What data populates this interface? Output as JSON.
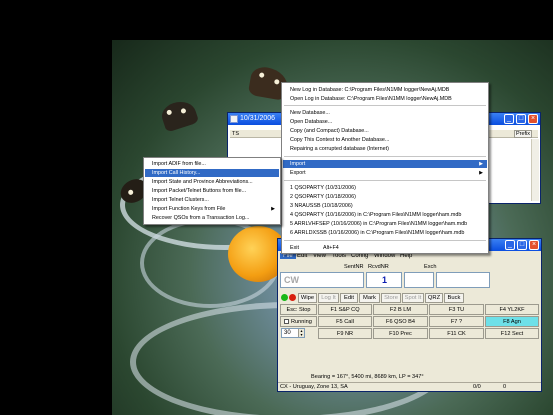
{
  "background_window": {
    "title": "10/31/2006",
    "column_a": "TS",
    "column_b": "Prefix"
  },
  "file_menu": {
    "items": [
      {
        "label": "New Log in Database: C:\\Program Files\\N1MM logger\\NewAj.MDB"
      },
      {
        "label": "Open Log in Database: C:\\Program Files\\N1MM logger\\NewAj.MDB"
      },
      {
        "label": "New Database..."
      },
      {
        "label": "Open Database..."
      },
      {
        "label": "Copy (and Compact) Database..."
      },
      {
        "label": "Copy This Contest to Another Database..."
      },
      {
        "label": "Repairing a corrupted database (Internet)"
      },
      {
        "label": "Import"
      },
      {
        "label": "Export"
      },
      {
        "label": "1 QSOPARTY (10/31/2006)"
      },
      {
        "label": "2 QSOPARTY (10/18/2006)"
      },
      {
        "label": "3 NRAUSSB (10/18/2006)"
      },
      {
        "label": "4 QSOPARTY (10/16/2006) in C:\\Program Files\\N1MM logger\\ham.mdb"
      },
      {
        "label": "5 ARRLVHFSEP (10/16/2006) in C:\\Program Files\\N1MM logger\\ham.mdb"
      },
      {
        "label": "6 ARRLDXSSB (10/16/2006) in C:\\Program Files\\N1MM logger\\ham.mdb"
      },
      {
        "label": "Exit",
        "shortcut": "Alt+F4"
      }
    ]
  },
  "import_submenu": {
    "items": [
      {
        "label": "Import ADIF from file..."
      },
      {
        "label": "Import Call History..."
      },
      {
        "label": "Import State and Province Abbreviations..."
      },
      {
        "label": "Import Packet/Telnet Buttons from file..."
      },
      {
        "label": "Import Telnet Clusters..."
      },
      {
        "label": "Import Function Keys from File"
      },
      {
        "label": "Recover QSOs from a Transaction Log..."
      }
    ]
  },
  "entry_window": {
    "menubar": [
      "File",
      "Edit",
      "View",
      "Tools",
      "Config",
      "Window",
      "Help"
    ],
    "headers": [
      "SentNR",
      "RcvdNR",
      "Exch"
    ],
    "call_placeholder": "CW",
    "sent_nr": "1",
    "buttons": [
      "Wipe",
      "Log It",
      "Edit",
      "Mark",
      "Store",
      "Spot It",
      "QRZ",
      "Buck"
    ],
    "disabled_buttons": [
      "Log It",
      "Store",
      "Spot It"
    ],
    "keys": [
      [
        "Esc: Stop",
        "F1 S&P CQ",
        "F2 B LM",
        "F3 TU",
        "F4 YL2KF"
      ],
      [
        "Running",
        "F5 Call",
        "F6 QSO B4",
        "F7 ?",
        "F8 Agn"
      ],
      [
        "30",
        "F9 NR",
        "F10 Prec",
        "F11 CK",
        "F12 Sect"
      ]
    ],
    "selected_key": "F8 Agn",
    "bearing_text": "Bearing = 167°, 5400  mi, 8689 km, LP = 347°",
    "status_country": "CX - Uruguay, Zone 13, SA",
    "status_count": "0/0",
    "status_zero": "0"
  }
}
